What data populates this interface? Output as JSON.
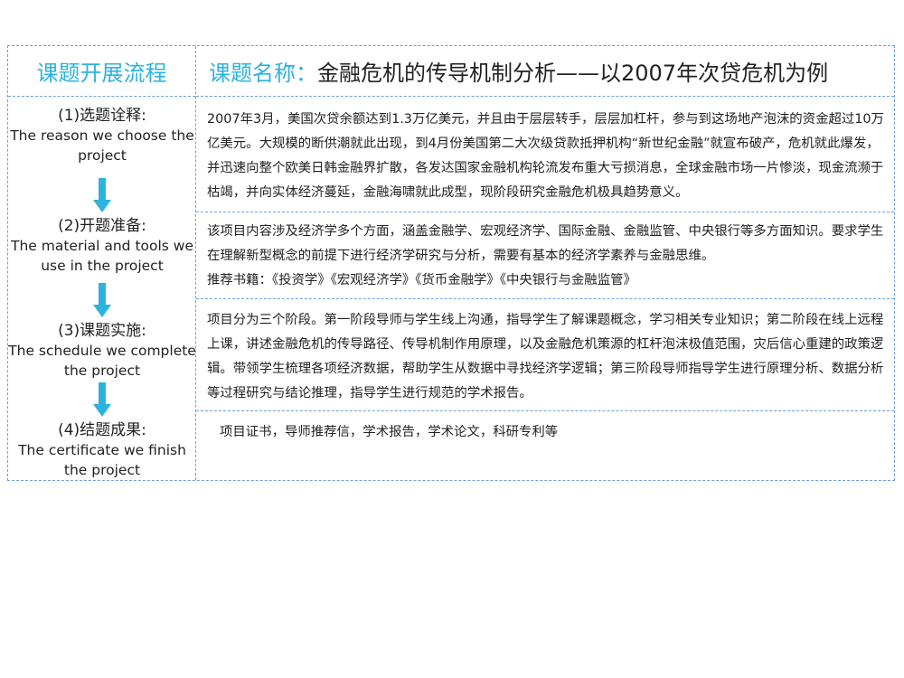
{
  "header": {
    "left_title": "课题开展流程",
    "right_label": "课题名称：",
    "right_title": "金融危机的传导机制分析——以2007年次贷危机为例"
  },
  "steps": [
    {
      "cn": "(1)选题诠释:",
      "en": "The reason we choose the project"
    },
    {
      "cn": "(2)开题准备:",
      "en": "The material and tools we use in the project"
    },
    {
      "cn": "(3)课题实施:",
      "en": "The schedule we complete the project"
    },
    {
      "cn": "(4)结题成果:",
      "en": "The certificate we finish the project"
    }
  ],
  "sections": {
    "s1": "2007年3月，美国次贷余额达到1.3万亿美元，并且由于层层转手，层层加杠杆，参与到这场地产泡沫的资金超过10万亿美元。大规模的断供潮就此出现，到4月份美国第二大次级贷款抵押机构“新世纪金融”就宣布破产，危机就此爆发，并迅速向整个欧美日韩金融界扩散，各发达国家金融机构轮流发布重大亏损消息，全球金融市场一片惨淡，现金流濒于枯竭，并向实体经济蔓延，金融海啸就此成型，现阶段研究金融危机极具趋势意义。",
    "s2_p1": "该项目内容涉及经济学多个方面，涵盖金融学、宏观经济学、国际金融、金融监管、中央银行等多方面知识。要求学生在理解新型概念的前提下进行经济学研究与分析，需要有基本的经济学素养与金融思维。",
    "s2_p2": "推荐书籍：《投资学》《宏观经济学》《货币金融学》《中央银行与金融监管》",
    "s3": "项目分为三个阶段。第一阶段导师与学生线上沟通，指导学生了解课题概念，学习相关专业知识；第二阶段在线上远程上课，讲述金融危机的传导路径、传导机制作用原理，以及金融危机策源的杠杆泡沫极值范围，灾后信心重建的政策逻辑。带领学生梳理各项经济数据，帮助学生从数据中寻找经济学逻辑；第三阶段导师指导学生进行原理分析、数据分析等过程研究与结论推理，指导学生进行规范的学术报告。",
    "s4": "项目证书，导师推荐信，学术报告，学术论文，科研专利等"
  },
  "colors": {
    "accent": "#2cb3dd",
    "border": "#6aa0d8",
    "text": "#222222"
  }
}
